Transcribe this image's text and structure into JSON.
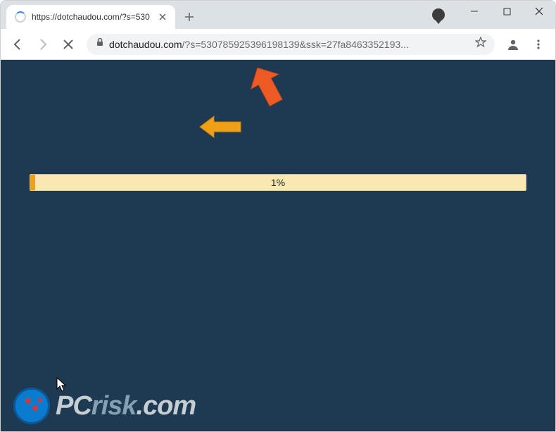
{
  "tab": {
    "title": "https://dotchaudou.com/?s=530"
  },
  "url": {
    "domain": "dotchaudou.com",
    "path": "/?s=530785925396198139&ssk=27fa8463352193..."
  },
  "progress": {
    "percent_text": "1%",
    "fill_percent": "1%"
  },
  "watermark": {
    "brand_a": "PC",
    "brand_b": "risk",
    "brand_c": ".com"
  },
  "colors": {
    "page_bg": "#1e3a52",
    "progress_bg": "#f9e8b1",
    "progress_fill": "#f0a015",
    "arrow_orange": "#ee5a24",
    "arrow_yellow": "#f0a015"
  }
}
